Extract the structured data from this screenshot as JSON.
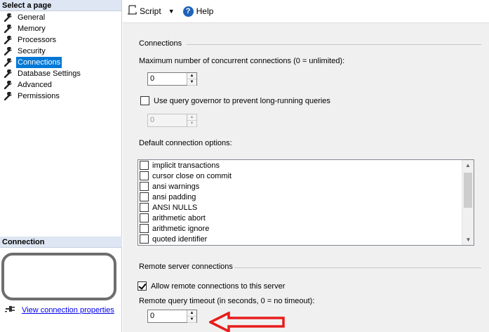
{
  "left_pane": {
    "header": "Select a page",
    "pages": [
      {
        "label": "General",
        "selected": false
      },
      {
        "label": "Memory",
        "selected": false
      },
      {
        "label": "Processors",
        "selected": false
      },
      {
        "label": "Security",
        "selected": false
      },
      {
        "label": "Connections",
        "selected": true
      },
      {
        "label": "Database Settings",
        "selected": false
      },
      {
        "label": "Advanced",
        "selected": false
      },
      {
        "label": "Permissions",
        "selected": false
      }
    ],
    "connection_header": "Connection",
    "connection_link": "View connection properties"
  },
  "toolbar": {
    "script_label": "Script",
    "help_label": "Help"
  },
  "connections": {
    "section_title": "Connections",
    "max_connections_label": "Maximum number of concurrent connections (0 = unlimited):",
    "max_connections_value": "0",
    "query_governor_label": "Use query governor to prevent long-running queries",
    "query_governor_checked": false,
    "query_governor_value": "0",
    "default_options_label": "Default connection options:",
    "options": [
      {
        "label": "implicit transactions",
        "checked": false
      },
      {
        "label": "cursor close on commit",
        "checked": false
      },
      {
        "label": "ansi warnings",
        "checked": false
      },
      {
        "label": "ansi padding",
        "checked": false
      },
      {
        "label": "ANSI NULLS",
        "checked": false
      },
      {
        "label": "arithmetic abort",
        "checked": false
      },
      {
        "label": "arithmetic ignore",
        "checked": false
      },
      {
        "label": "quoted identifier",
        "checked": false
      }
    ]
  },
  "remote": {
    "section_title": "Remote server connections",
    "allow_remote_label": "Allow remote connections to this server",
    "allow_remote_checked": true,
    "timeout_label": "Remote query timeout (in seconds, 0 = no timeout):",
    "timeout_value": "0"
  },
  "colors": {
    "selected_item": "#0078d7",
    "annotation_arrow": "#e81c1c",
    "link": "#0000ee"
  }
}
